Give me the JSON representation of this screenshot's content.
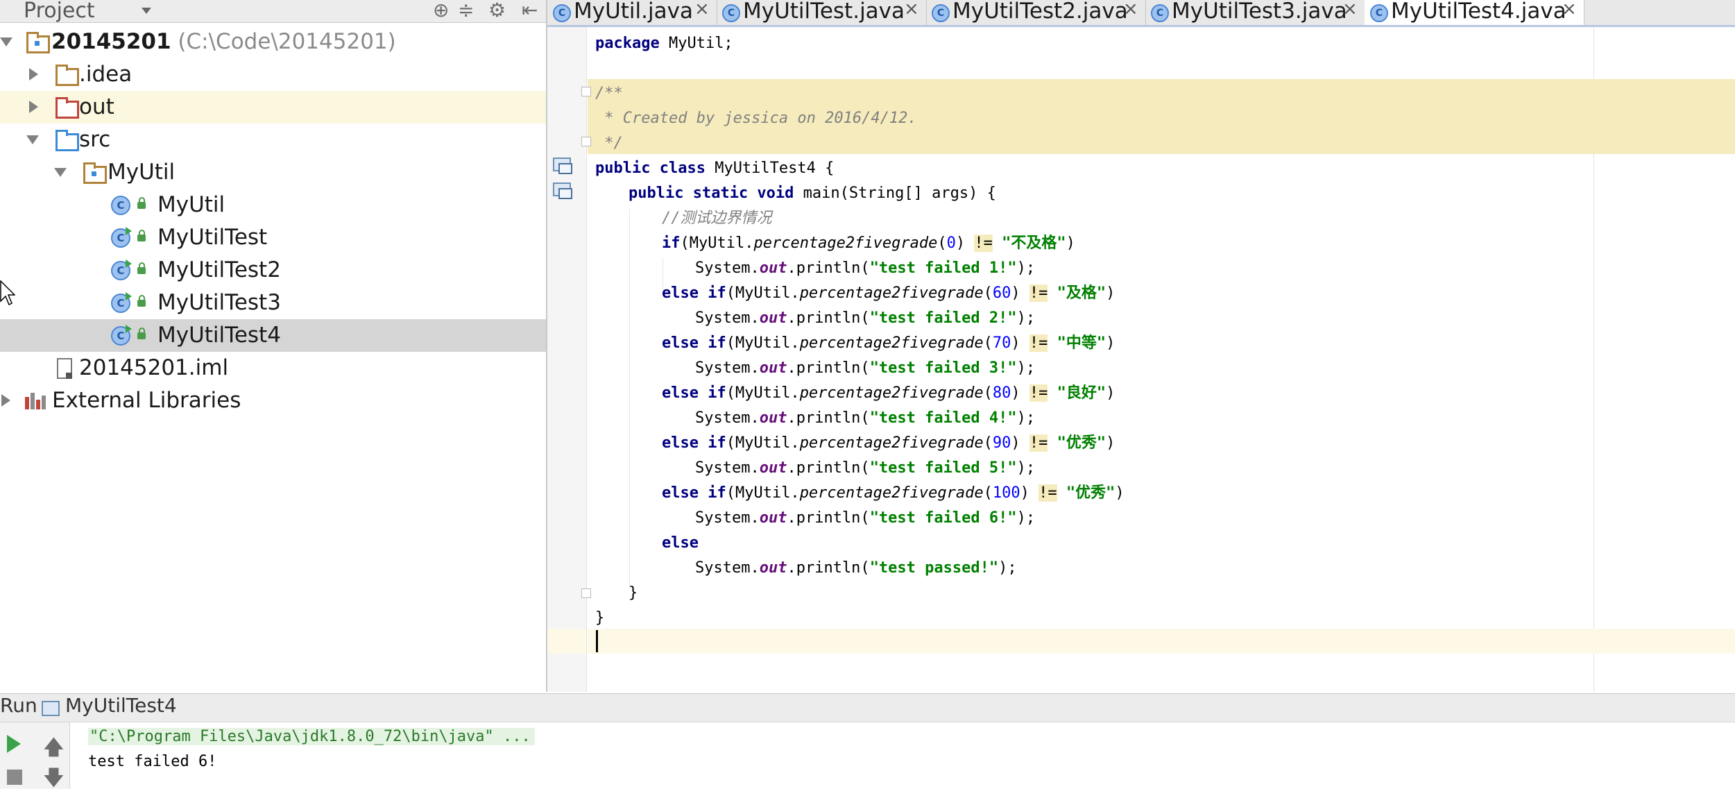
{
  "project_panel": {
    "title": "Project",
    "tree": {
      "root_name": "20145201",
      "root_path": "(C:\\Code\\20145201)",
      "idea": ".idea",
      "out": "out",
      "src": "src",
      "package": "MyUtil",
      "classes": [
        "MyUtil",
        "MyUtilTest",
        "MyUtilTest2",
        "MyUtilTest3",
        "MyUtilTest4"
      ],
      "iml": "20145201.iml",
      "external": "External Libraries"
    }
  },
  "tabs": [
    {
      "label": "MyUtil.java",
      "active": false
    },
    {
      "label": "MyUtilTest.java",
      "active": false
    },
    {
      "label": "MyUtilTest2.java",
      "active": false
    },
    {
      "label": "MyUtilTest3.java",
      "active": false
    },
    {
      "label": "MyUtilTest4.java",
      "active": true
    }
  ],
  "editor": {
    "l1_pkg_kw": "package",
    "l1_pkg_name": " MyUtil;",
    "c1": "/**",
    "c2": " * Created by jessica on 2016/4/12.",
    "c3": " */",
    "class_kw": "public class",
    "class_name": " MyUtilTest4 {",
    "main_kw": "public static void",
    "main_sig": " main(String[] args) {",
    "comment": "//测试边界情况",
    "kw_if": "if",
    "kw_else_if": "else if",
    "kw_else": "else",
    "cls_ref": "(MyUtil.",
    "method": "percentage2fivegrade",
    "op_ne": "!=",
    "sys": "System.",
    "out": "out",
    "println": ".println(",
    "conditions": [
      {
        "num": "0",
        "str": "\"不及格\""
      },
      {
        "num": "60",
        "str": "\"及格\""
      },
      {
        "num": "70",
        "str": "\"中等\""
      },
      {
        "num": "80",
        "str": "\"良好\""
      },
      {
        "num": "90",
        "str": "\"优秀\""
      },
      {
        "num": "100",
        "str": "\"优秀\""
      }
    ],
    "messages": [
      "\"test failed 1!\"",
      "\"test failed 2!\"",
      "\"test failed 3!\"",
      "\"test failed 4!\"",
      "\"test failed 5!\"",
      "\"test failed 6!\""
    ],
    "passed": "\"test passed!\"",
    "brace_close_method": "}",
    "brace_close_class": "}"
  },
  "run_panel": {
    "label": "Run",
    "config": "MyUtilTest4",
    "console": [
      "\"C:\\Program Files\\Java\\jdk1.8.0_72\\bin\\java\" ...",
      "test failed 6!"
    ]
  }
}
